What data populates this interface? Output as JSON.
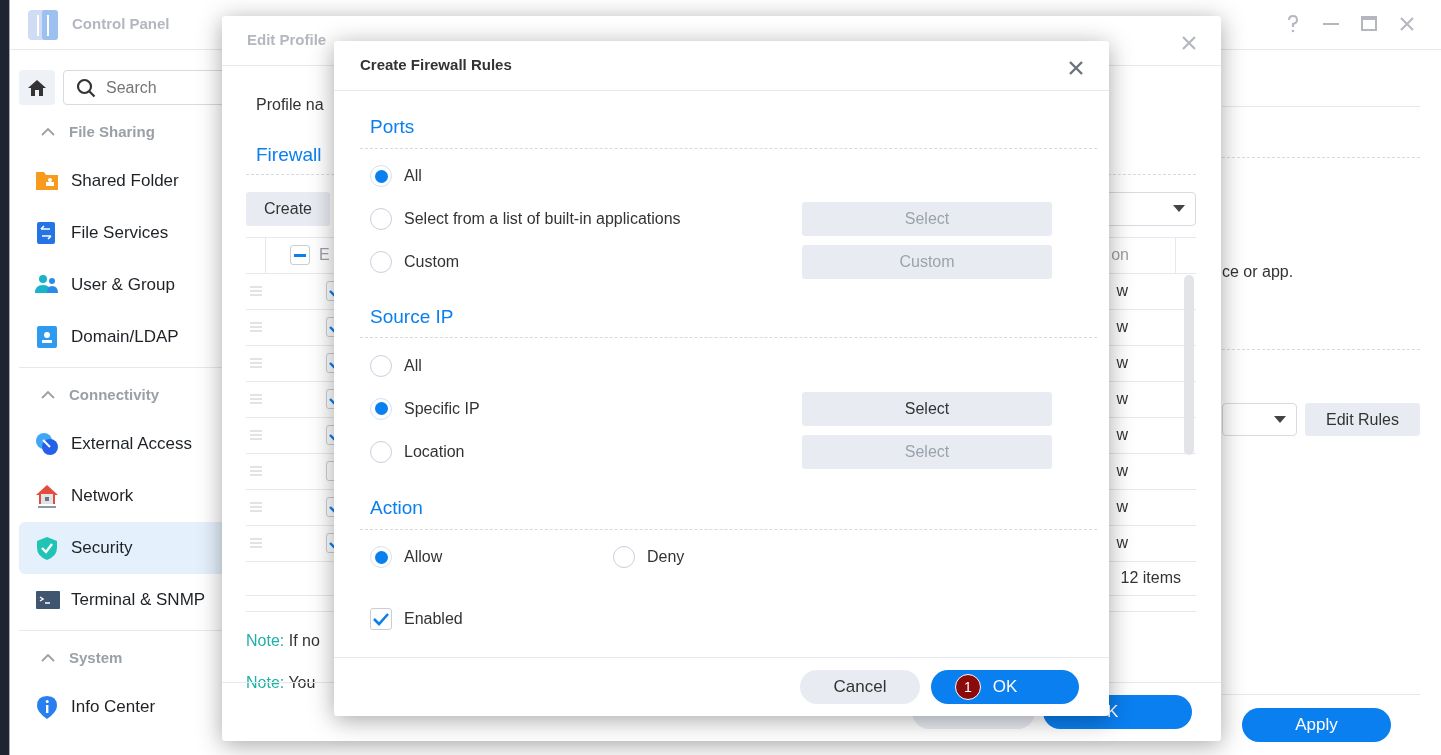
{
  "control_panel": {
    "title": "Control Panel",
    "search_placeholder": "Search",
    "sidebar": [
      {
        "kind": "group",
        "label": "File Sharing",
        "expanded": true
      },
      {
        "kind": "item",
        "label": "Shared Folder",
        "selected": false
      },
      {
        "kind": "item",
        "label": "File Services",
        "selected": false
      },
      {
        "kind": "item",
        "label": "User & Group",
        "selected": false
      },
      {
        "kind": "item",
        "label": "Domain/LDAP",
        "selected": false
      },
      {
        "kind": "group",
        "label": "Connectivity",
        "expanded": true
      },
      {
        "kind": "item",
        "label": "External Access",
        "selected": false
      },
      {
        "kind": "item",
        "label": "Network",
        "selected": false
      },
      {
        "kind": "item",
        "label": "Security",
        "selected": true
      },
      {
        "kind": "item",
        "label": "Terminal & SNMP",
        "selected": false
      },
      {
        "kind": "group",
        "label": "System",
        "expanded": true
      },
      {
        "kind": "item",
        "label": "Info Center",
        "selected": false
      }
    ],
    "hint": "ce or app.",
    "edit_rules": "Edit Rules",
    "apply": "Apply"
  },
  "edit_profile": {
    "title": "Edit Profile",
    "profile_label": "Profile na",
    "section": "Firewall",
    "create": "Create",
    "header": {
      "indeterminate": true,
      "col_1": "E",
      "col_2": "on"
    },
    "rows": [
      {
        "checked": true,
        "column_2": "w"
      },
      {
        "checked": true,
        "column_2": "w"
      },
      {
        "checked": true,
        "column_2": "w"
      },
      {
        "checked": true,
        "column_2": "w"
      },
      {
        "checked": true,
        "column_2": "w"
      },
      {
        "checked": false,
        "column_2": "w"
      },
      {
        "checked": true,
        "column_2": "w"
      },
      {
        "checked": true,
        "column_2": "w"
      }
    ],
    "count": "12 items",
    "notes": [
      {
        "label": "Note:",
        "text": "If no"
      },
      {
        "label": "Note:",
        "text": "You"
      }
    ],
    "ok": "K"
  },
  "firewall_dialog": {
    "title": "Create Firewall Rules",
    "sections": [
      {
        "title": "Ports",
        "options": [
          {
            "label": "All",
            "selected": true
          },
          {
            "label": "Select from a list of built-in applications",
            "selected": false,
            "button": "Select",
            "button_disabled": true
          },
          {
            "label": "Custom",
            "selected": false,
            "button": "Custom",
            "button_disabled": true
          }
        ]
      },
      {
        "title": "Source IP",
        "options": [
          {
            "label": "All",
            "selected": false
          },
          {
            "label": "Specific IP",
            "selected": true,
            "button": "Select",
            "button_disabled": false
          },
          {
            "label": "Location",
            "selected": false,
            "button": "Select",
            "button_disabled": true
          }
        ]
      },
      {
        "title": "Action",
        "options": [
          {
            "label": "Allow",
            "selected": true
          },
          {
            "label": "Deny",
            "selected": false
          }
        ]
      }
    ],
    "enabled": {
      "label": "Enabled",
      "checked": true
    },
    "cancel": "Cancel",
    "ok": "OK",
    "step_badge": "1"
  }
}
